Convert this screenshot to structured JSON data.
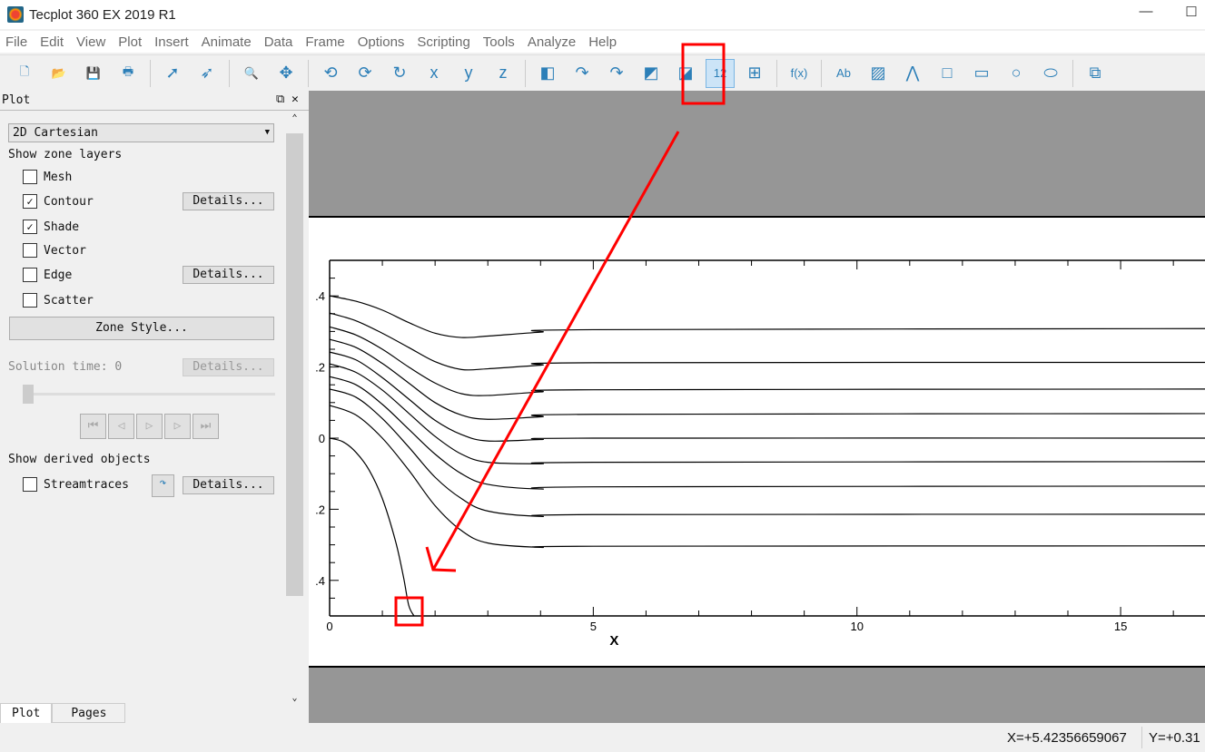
{
  "window": {
    "title": "Tecplot 360 EX 2019 R1",
    "minimize": "—",
    "maximize": "☐"
  },
  "menu": [
    "File",
    "Edit",
    "View",
    "Plot",
    "Insert",
    "Animate",
    "Data",
    "Frame",
    "Options",
    "Scripting",
    "Tools",
    "Analyze",
    "Help"
  ],
  "toolbar": [
    {
      "icon": "new-file-icon",
      "glyph": "🗋"
    },
    {
      "icon": "open-file-icon",
      "glyph": "📂"
    },
    {
      "icon": "save-icon",
      "glyph": "💾"
    },
    {
      "icon": "print-icon",
      "glyph": "🖶"
    },
    {
      "sep": true
    },
    {
      "icon": "select-arrow-icon",
      "glyph": "➚"
    },
    {
      "icon": "adjustor-icon",
      "glyph": "➶"
    },
    {
      "sep": true
    },
    {
      "icon": "zoom-icon",
      "glyph": "🔍"
    },
    {
      "icon": "translate-icon",
      "glyph": "✥"
    },
    {
      "sep": true
    },
    {
      "icon": "rotate-spherical-icon",
      "glyph": "⟲"
    },
    {
      "icon": "rotate-rollerball-icon",
      "glyph": "⟳"
    },
    {
      "icon": "rotate-twist-icon",
      "glyph": "↻"
    },
    {
      "icon": "rotate-x-icon",
      "glyph": "x"
    },
    {
      "icon": "rotate-y-icon",
      "glyph": "y"
    },
    {
      "icon": "rotate-z-icon",
      "glyph": "z"
    },
    {
      "sep": true
    },
    {
      "icon": "slice-icon",
      "glyph": "◧"
    },
    {
      "icon": "streamtrace-add-icon",
      "glyph": "↷"
    },
    {
      "icon": "streamtrace-remove-icon",
      "glyph": "↷"
    },
    {
      "icon": "contour-add-icon",
      "glyph": "◩"
    },
    {
      "icon": "contour-remove-icon",
      "glyph": "◪"
    },
    {
      "icon": "contour-label-add-icon",
      "glyph": "12",
      "active": true
    },
    {
      "icon": "probe-icon",
      "glyph": "⊞"
    },
    {
      "sep": true
    },
    {
      "icon": "equation-icon",
      "glyph": "f(x)"
    },
    {
      "sep": true
    },
    {
      "icon": "text-icon",
      "glyph": "Ab"
    },
    {
      "icon": "insert-image-icon",
      "glyph": "▨"
    },
    {
      "icon": "polyline-icon",
      "glyph": "⋀"
    },
    {
      "icon": "square-icon",
      "glyph": "□"
    },
    {
      "icon": "rectangle-icon",
      "glyph": "▭"
    },
    {
      "icon": "circle-icon",
      "glyph": "○"
    },
    {
      "icon": "ellipse-icon",
      "glyph": "⬭"
    },
    {
      "sep": true
    },
    {
      "icon": "new-frame-icon",
      "glyph": "⧉"
    }
  ],
  "panel": {
    "title": "Plot",
    "plot_type": "2D Cartesian",
    "zone_layers_label": "Show zone layers",
    "layers": [
      {
        "label": "Mesh",
        "checked": false
      },
      {
        "label": "Contour",
        "checked": true,
        "details": "Details..."
      },
      {
        "label": "Shade",
        "checked": true
      },
      {
        "label": "Vector",
        "checked": false
      },
      {
        "label": "Edge",
        "checked": false,
        "details": "Details..."
      },
      {
        "label": "Scatter",
        "checked": false
      }
    ],
    "zone_style": "Zone Style...",
    "solution_time": "Solution time: 0",
    "solution_details": "Details...",
    "derived_label": "Show derived objects",
    "streamtraces": {
      "label": "Streamtraces",
      "checked": false,
      "details": "Details..."
    },
    "tabs": [
      "Plot",
      "Pages"
    ]
  },
  "status": {
    "x": "X=+5.42356659067",
    "y": "Y=+0.31"
  },
  "colors": {
    "annotation": "#ff0000",
    "workspace": "#969696"
  },
  "chart_data": {
    "type": "line",
    "xlabel": "X",
    "ylabel": "",
    "xlim": [
      0,
      16.6
    ],
    "ylim": [
      -0.5,
      0.5
    ],
    "xticks": [
      {
        "v": 0,
        "label": "0"
      },
      {
        "v": 5,
        "label": "5"
      },
      {
        "v": 10,
        "label": "10"
      },
      {
        "v": 15,
        "label": "15"
      }
    ],
    "yticks": [
      {
        "v": 0.4,
        "label": ".4"
      },
      {
        "v": 0.2,
        "label": ".2"
      },
      {
        "v": 0,
        "label": "0"
      },
      {
        "v": -0.2,
        "label": ".2"
      },
      {
        "v": -0.4,
        "label": ".4"
      }
    ],
    "grid": false,
    "series": [
      {
        "x": [
          0,
          0.5,
          1,
          1.5,
          2,
          2.5,
          3,
          4,
          5,
          16.6
        ],
        "y": [
          0.4,
          0.385,
          0.36,
          0.325,
          0.295,
          0.283,
          0.287,
          0.298,
          0.305,
          0.308
        ]
      },
      {
        "x": [
          0,
          0.5,
          1,
          1.5,
          2,
          2.5,
          3,
          4,
          5,
          16.6
        ],
        "y": [
          0.352,
          0.33,
          0.295,
          0.255,
          0.215,
          0.193,
          0.195,
          0.205,
          0.212,
          0.213
        ]
      },
      {
        "x": [
          0,
          0.5,
          1,
          1.5,
          2,
          2.5,
          3,
          4,
          5,
          16.6
        ],
        "y": [
          0.313,
          0.29,
          0.25,
          0.2,
          0.155,
          0.125,
          0.12,
          0.13,
          0.136,
          0.138
        ]
      },
      {
        "x": [
          0,
          0.5,
          1,
          1.5,
          2,
          2.5,
          3,
          4,
          5,
          16.6
        ],
        "y": [
          0.278,
          0.255,
          0.21,
          0.155,
          0.1,
          0.065,
          0.053,
          0.06,
          0.067,
          0.069
        ]
      },
      {
        "x": [
          0,
          0.5,
          1,
          1.5,
          2,
          2.5,
          3,
          4,
          5,
          16.6
        ],
        "y": [
          0.242,
          0.22,
          0.17,
          0.11,
          0.05,
          0.01,
          -0.008,
          -0.004,
          0,
          0
        ]
      },
      {
        "x": [
          0,
          0.5,
          1,
          1.5,
          2,
          2.5,
          3,
          4,
          5,
          16.6
        ],
        "y": [
          0.209,
          0.185,
          0.135,
          0.07,
          0.005,
          -0.045,
          -0.068,
          -0.072,
          -0.068,
          -0.066
        ]
      },
      {
        "x": [
          0,
          0.5,
          1,
          1.5,
          2,
          2.5,
          3,
          4,
          5,
          16.6
        ],
        "y": [
          0.173,
          0.15,
          0.095,
          0.025,
          -0.045,
          -0.1,
          -0.13,
          -0.143,
          -0.137,
          -0.135
        ]
      },
      {
        "x": [
          0,
          0.5,
          1,
          1.5,
          2,
          2.5,
          3,
          4,
          5,
          16.6
        ],
        "y": [
          0.138,
          0.115,
          0.055,
          -0.025,
          -0.11,
          -0.17,
          -0.205,
          -0.22,
          -0.215,
          -0.214
        ]
      },
      {
        "x": [
          0,
          0.5,
          1,
          1.5,
          2,
          2.5,
          3,
          4,
          5,
          16.6
        ],
        "y": [
          0.092,
          0.065,
          0.0,
          -0.09,
          -0.19,
          -0.26,
          -0.295,
          -0.307,
          -0.304,
          -0.303
        ]
      },
      {
        "x": [
          0,
          0.25,
          0.5,
          0.75,
          1,
          1.25,
          1.4,
          1.5,
          1.6
        ],
        "y": [
          0,
          -0.01,
          -0.04,
          -0.09,
          -0.17,
          -0.29,
          -0.39,
          -0.47,
          -0.5
        ]
      }
    ]
  }
}
